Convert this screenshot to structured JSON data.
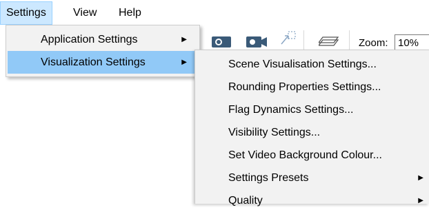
{
  "menubar": {
    "items": [
      {
        "label": "Settings",
        "active": true
      },
      {
        "label": "View",
        "active": false
      },
      {
        "label": "Help",
        "active": false
      }
    ]
  },
  "toolbar": {
    "zoom_label": "Zoom:",
    "zoom_value": "10%"
  },
  "settings_menu": {
    "items": [
      {
        "label": "Application Settings",
        "has_submenu": true,
        "highlighted": false
      },
      {
        "label": "Visualization Settings",
        "has_submenu": true,
        "highlighted": true
      }
    ]
  },
  "visualization_submenu": {
    "items": [
      {
        "label": "Scene Visualisation Settings...",
        "has_submenu": false
      },
      {
        "label": "Rounding Properties Settings...",
        "has_submenu": false
      },
      {
        "label": "Flag Dynamics Settings...",
        "has_submenu": false
      },
      {
        "label": "Visibility Settings...",
        "has_submenu": false
      },
      {
        "label": "Set Video Background Colour...",
        "has_submenu": false
      },
      {
        "label": "Settings Presets",
        "has_submenu": true
      },
      {
        "label": "Quality",
        "has_submenu": true
      }
    ]
  },
  "colors": {
    "menubar_active_bg": "#cce8ff",
    "menu_bg": "#f2f2f2",
    "highlight_bg": "#91c9f7"
  },
  "icons": [
    "submenu-arrow-icon",
    "camera-icon",
    "video-camera-icon",
    "expand-icon",
    "layers-icon"
  ]
}
